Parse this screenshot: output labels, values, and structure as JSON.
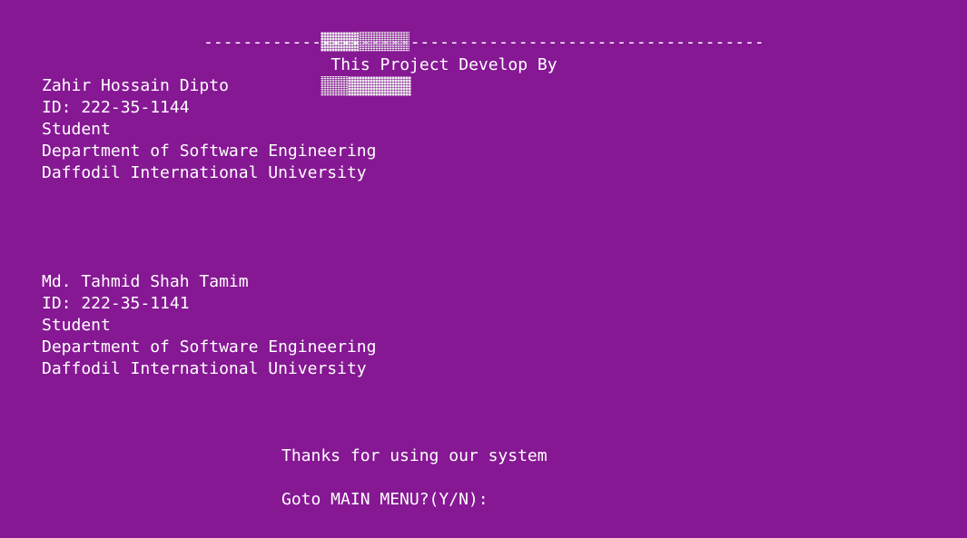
{
  "header": {
    "title": "This Project Develop By",
    "divider": "---------------------------------------------------------"
  },
  "developers": [
    {
      "name": "Zahir Hossain Dipto",
      "id": "ID: 222-35-1144",
      "role": "Student",
      "department": "Department of Software Engineering",
      "university": "Daffodil International University"
    },
    {
      "name": "Md. Tahmid Shah Tamim",
      "id": "ID: 222-35-1141",
      "role": "Student",
      "department": "Department of Software Engineering",
      "university": "Daffodil International University"
    }
  ],
  "footer": {
    "thanks": "Thanks for using our system",
    "prompt": "Goto MAIN MENU?(Y/N):"
  },
  "colors": {
    "background": "#861894",
    "text": "#ffffff"
  }
}
